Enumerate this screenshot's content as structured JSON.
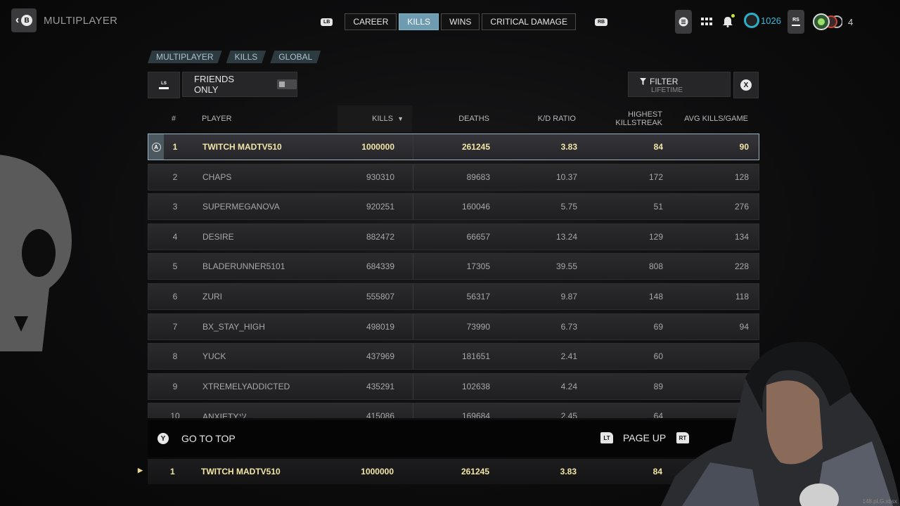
{
  "header": {
    "back_key": "B",
    "title": "MULTIPLAYER",
    "lb": "LB",
    "rb": "RB",
    "tabs": [
      {
        "label": "CAREER",
        "active": false
      },
      {
        "label": "KILLS",
        "active": true
      },
      {
        "label": "WINS",
        "active": false
      },
      {
        "label": "CRITICAL DAMAGE",
        "active": false
      }
    ],
    "cod_points": "1026",
    "rs_key": "RS",
    "party_count": "4"
  },
  "breadcrumb": [
    "MULTIPLAYER",
    "KILLS",
    "GLOBAL"
  ],
  "controls": {
    "ls_key": "LS",
    "friends_only_label": "FRIENDS ONLY",
    "friends_only_on": false,
    "filter_label": "FILTER",
    "filter_value": "LIFETIME",
    "close_key": "X"
  },
  "table": {
    "columns": {
      "rank": "#",
      "player": "PLAYER",
      "kills": "KILLS",
      "deaths": "DEATHS",
      "kd": "K/D RATIO",
      "killstreak_1": "HIGHEST",
      "killstreak_2": "KILLSTREAK",
      "avg": "AVG KILLS/GAME"
    },
    "sort_column": "kills",
    "sort_direction": "desc",
    "selected_key": "A",
    "rows": [
      {
        "rank": "1",
        "player": "TWITCH MADTV510",
        "kills": "1000000",
        "deaths": "261245",
        "kd": "3.83",
        "killstreak": "84",
        "avg": "90"
      },
      {
        "rank": "2",
        "player": "CHAPS",
        "kills": "930310",
        "deaths": "89683",
        "kd": "10.37",
        "killstreak": "172",
        "avg": "128"
      },
      {
        "rank": "3",
        "player": "SUPERMEGANOVA",
        "kills": "920251",
        "deaths": "160046",
        "kd": "5.75",
        "killstreak": "51",
        "avg": "276"
      },
      {
        "rank": "4",
        "player": "DESIRE",
        "kills": "882472",
        "deaths": "66657",
        "kd": "13.24",
        "killstreak": "129",
        "avg": "134"
      },
      {
        "rank": "5",
        "player": "BLADERUNNER5101",
        "kills": "684339",
        "deaths": "17305",
        "kd": "39.55",
        "killstreak": "808",
        "avg": "228"
      },
      {
        "rank": "6",
        "player": "ZURI",
        "kills": "555807",
        "deaths": "56317",
        "kd": "9.87",
        "killstreak": "148",
        "avg": "118"
      },
      {
        "rank": "7",
        "player": "BX_STAY_HIGH",
        "kills": "498019",
        "deaths": "73990",
        "kd": "6.73",
        "killstreak": "69",
        "avg": "94"
      },
      {
        "rank": "8",
        "player": "YUCK",
        "kills": "437969",
        "deaths": "181651",
        "kd": "2.41",
        "killstreak": "60",
        "avg": ""
      },
      {
        "rank": "9",
        "player": "XTREMELYADDICTED",
        "kills": "435291",
        "deaths": "102638",
        "kd": "4.24",
        "killstreak": "89",
        "avg": ""
      },
      {
        "rank": "10",
        "player": "ANXIETYツ",
        "kills": "415086",
        "deaths": "169684",
        "kd": "2.45",
        "killstreak": "64",
        "avg": ""
      }
    ]
  },
  "footer": {
    "go_to_top_key": "Y",
    "go_to_top_label": "GO TO TOP",
    "page_up_key": "LT",
    "page_up_label": "PAGE UP",
    "page_down_key": "RT"
  },
  "my_row": {
    "rank": "1",
    "player": "TWITCH MADTV510",
    "kills": "1000000",
    "deaths": "261245",
    "kd": "3.83",
    "killstreak": "84"
  },
  "watermark": "148.pLG.xbsx",
  "colors": {
    "accent": "#6f9bb0",
    "highlight_text": "#f2e6a6",
    "cod_points": "#3ab8d6"
  }
}
